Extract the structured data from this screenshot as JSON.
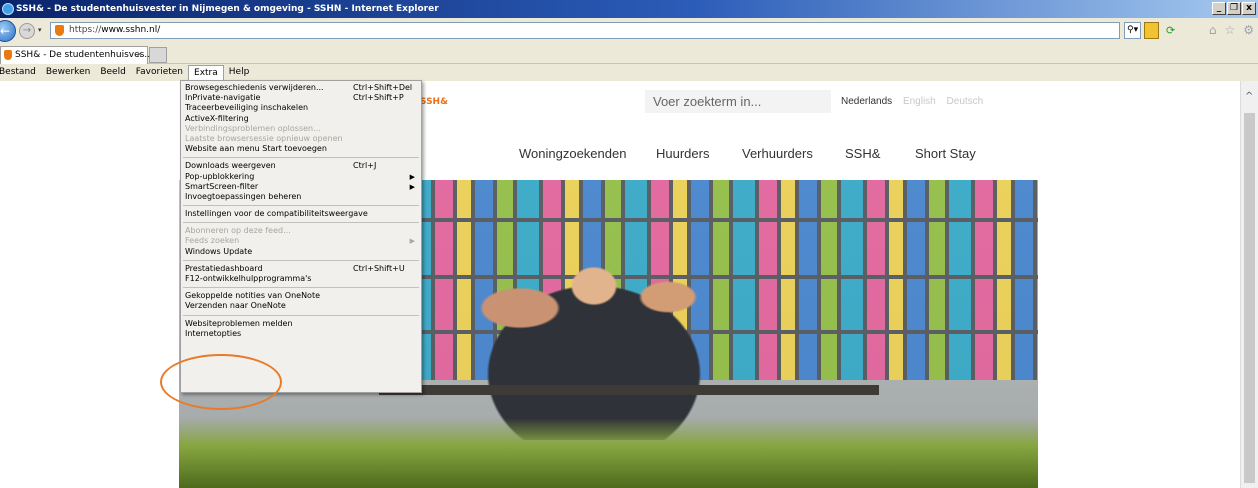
{
  "window": {
    "title": "SSH& - De studentenhuisvester in Nijmegen & omgeving - SSHN - Internet Explorer",
    "minimize": "_",
    "restore": "❐",
    "close": "x"
  },
  "address_bar": {
    "url_prefix": "https://",
    "url_domain": "www.sshn.nl/",
    "search_icon": "⚲",
    "dropdown_icon": "▾"
  },
  "tabs": [
    {
      "label": "SSH& - De studentenhuisves...",
      "close": "×"
    }
  ],
  "menubar": {
    "items": [
      "Bestand",
      "Bewerken",
      "Beeld",
      "Favorieten",
      "Extra",
      "Help"
    ],
    "active": "Extra"
  },
  "extra_menu": {
    "groups": [
      [
        {
          "label": "Browsegeschiedenis verwijderen...",
          "shortcut": "Ctrl+Shift+Del"
        },
        {
          "label": "InPrivate-navigatie",
          "shortcut": "Ctrl+Shift+P"
        },
        {
          "label": "Traceerbeveiliging inschakelen"
        },
        {
          "label": "ActiveX-filtering"
        },
        {
          "label": "Verbindingsproblemen oplossen...",
          "disabled": true
        },
        {
          "label": "Laatste browsersessie opnieuw openen",
          "disabled": true
        },
        {
          "label": "Website aan menu Start toevoegen"
        }
      ],
      [
        {
          "label": "Downloads weergeven",
          "shortcut": "Ctrl+J"
        },
        {
          "label": "Pop-upblokkering",
          "submenu": true
        },
        {
          "label": "SmartScreen-filter",
          "submenu": true
        },
        {
          "label": "Invoegtoepassingen beheren"
        }
      ],
      [
        {
          "label": "Instellingen voor de compatibiliteitsweergave"
        }
      ],
      [
        {
          "label": "Abonneren op deze feed...",
          "disabled": true
        },
        {
          "label": "Feeds zoeken",
          "disabled": true,
          "submenu": true
        },
        {
          "label": "Windows Update"
        }
      ],
      [
        {
          "label": "Prestatiedashboard",
          "shortcut": "Ctrl+Shift+U"
        },
        {
          "label": "F12-ontwikkelhulpprogramma's"
        }
      ],
      [
        {
          "label": "Gekoppelde notities van OneNote"
        },
        {
          "label": "Verzenden naar OneNote"
        }
      ],
      [
        {
          "label": "Websiteproblemen melden"
        },
        {
          "label": "Internetopties"
        }
      ]
    ]
  },
  "site": {
    "brand": "SSH&",
    "search_placeholder": "Voer zoekterm in...",
    "languages": [
      "Nederlands",
      "English",
      "Deutsch"
    ],
    "active_language": "Nederlands",
    "nav": [
      "Woningzoekenden",
      "Huurders",
      "Verhuurders",
      "SSH&",
      "Short Stay"
    ]
  },
  "colors": {
    "brand_orange": "#e8701a",
    "highlight_ring": "#e87a2a"
  }
}
